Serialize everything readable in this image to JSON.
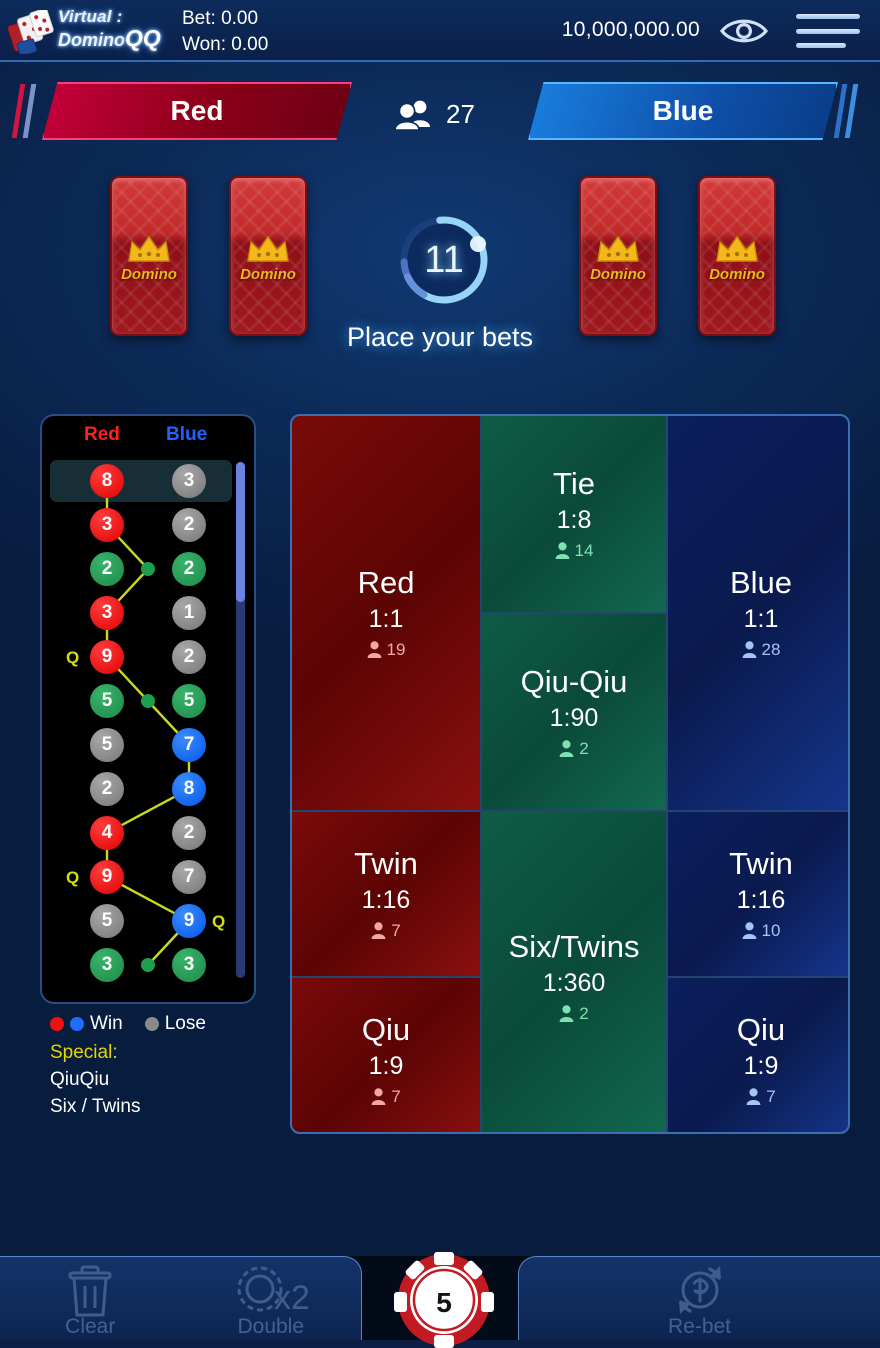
{
  "header": {
    "logo_line1": "Virtual :",
    "logo_line2": "Domino",
    "logo_qq": "QQ",
    "bet_label": "Bet: 0.00",
    "won_label": "Won: 0.00",
    "balance": "10,000,000.00",
    "eye_icon": "eye-icon",
    "menu_icon": "hamburger-menu-icon"
  },
  "teams": {
    "red_label": "Red",
    "blue_label": "Blue",
    "players_icon": "people-icon",
    "players_count": "27"
  },
  "table": {
    "card_label": "Domino",
    "cards": [
      {
        "id": "card-1",
        "label": "Domino"
      },
      {
        "id": "card-2",
        "label": "Domino"
      },
      {
        "id": "card-3",
        "label": "Domino"
      },
      {
        "id": "card-4",
        "label": "Domino"
      }
    ],
    "timer_value": "11",
    "status_text": "Place your bets"
  },
  "roadmap": {
    "header_red": "Red",
    "header_blue": "Blue",
    "rows": [
      {
        "red": {
          "value": "8",
          "color": "red"
        },
        "blue": {
          "value": "3",
          "color": "grey"
        },
        "q_left": "",
        "q_right": ""
      },
      {
        "red": {
          "value": "3",
          "color": "red"
        },
        "blue": {
          "value": "2",
          "color": "grey"
        },
        "q_left": "",
        "q_right": ""
      },
      {
        "red": {
          "value": "2",
          "color": "green"
        },
        "blue": {
          "value": "2",
          "color": "green"
        },
        "q_left": "",
        "q_right": ""
      },
      {
        "red": {
          "value": "3",
          "color": "red"
        },
        "blue": {
          "value": "1",
          "color": "grey"
        },
        "q_left": "",
        "q_right": ""
      },
      {
        "red": {
          "value": "9",
          "color": "red"
        },
        "blue": {
          "value": "2",
          "color": "grey"
        },
        "q_left": "Q",
        "q_right": ""
      },
      {
        "red": {
          "value": "5",
          "color": "green"
        },
        "blue": {
          "value": "5",
          "color": "green"
        },
        "q_left": "",
        "q_right": ""
      },
      {
        "red": {
          "value": "5",
          "color": "grey"
        },
        "blue": {
          "value": "7",
          "color": "blue"
        },
        "q_left": "",
        "q_right": ""
      },
      {
        "red": {
          "value": "2",
          "color": "grey"
        },
        "blue": {
          "value": "8",
          "color": "blue"
        },
        "q_left": "",
        "q_right": ""
      },
      {
        "red": {
          "value": "4",
          "color": "red"
        },
        "blue": {
          "value": "2",
          "color": "grey"
        },
        "q_left": "",
        "q_right": ""
      },
      {
        "red": {
          "value": "9",
          "color": "red"
        },
        "blue": {
          "value": "7",
          "color": "grey"
        },
        "q_left": "Q",
        "q_right": ""
      },
      {
        "red": {
          "value": "5",
          "color": "grey"
        },
        "blue": {
          "value": "9",
          "color": "blue"
        },
        "q_left": "",
        "q_right": "Q"
      },
      {
        "red": {
          "value": "3",
          "color": "green"
        },
        "blue": {
          "value": "3",
          "color": "green"
        },
        "q_left": "",
        "q_right": ""
      }
    ]
  },
  "legend": {
    "win_label": "Win",
    "lose_label": "Lose",
    "special_label": "Special:",
    "special_items": [
      "QiuQiu",
      "Six / Twins"
    ]
  },
  "bets": {
    "red": {
      "name": "Red",
      "odds": "1:1",
      "players": "19",
      "side": "red"
    },
    "tie": {
      "name": "Tie",
      "odds": "1:8",
      "players": "14",
      "side": "green"
    },
    "qiuqiu": {
      "name": "Qiu-Qiu",
      "odds": "1:90",
      "players": "2",
      "side": "green"
    },
    "blue": {
      "name": "Blue",
      "odds": "1:1",
      "players": "28",
      "side": "blue"
    },
    "twin_red": {
      "name": "Twin",
      "odds": "1:16",
      "players": "7",
      "side": "red"
    },
    "qiu_red": {
      "name": "Qiu",
      "odds": "1:9",
      "players": "7",
      "side": "red"
    },
    "sixtwins": {
      "name": "Six/Twins",
      "odds": "1:360",
      "players": "2",
      "side": "green"
    },
    "twin_blue": {
      "name": "Twin",
      "odds": "1:16",
      "players": "10",
      "side": "blue"
    },
    "qiu_blue": {
      "name": "Qiu",
      "odds": "1:9",
      "players": "7",
      "side": "blue"
    }
  },
  "toolbar": {
    "clear_label": "Clear",
    "clear_icon": "trash-icon",
    "double_label": "Double",
    "double_icon": "chip-x2-icon",
    "rebet_label": "Re-bet",
    "rebet_icon": "refresh-dollar-icon",
    "chip_value": "5",
    "chip_icon": "casino-chip-icon"
  },
  "colors": {
    "red": "#c8003c",
    "blue": "#1a7fe0",
    "green": "#12694f",
    "gold": "#e8d400",
    "bg": "#0b2044"
  }
}
